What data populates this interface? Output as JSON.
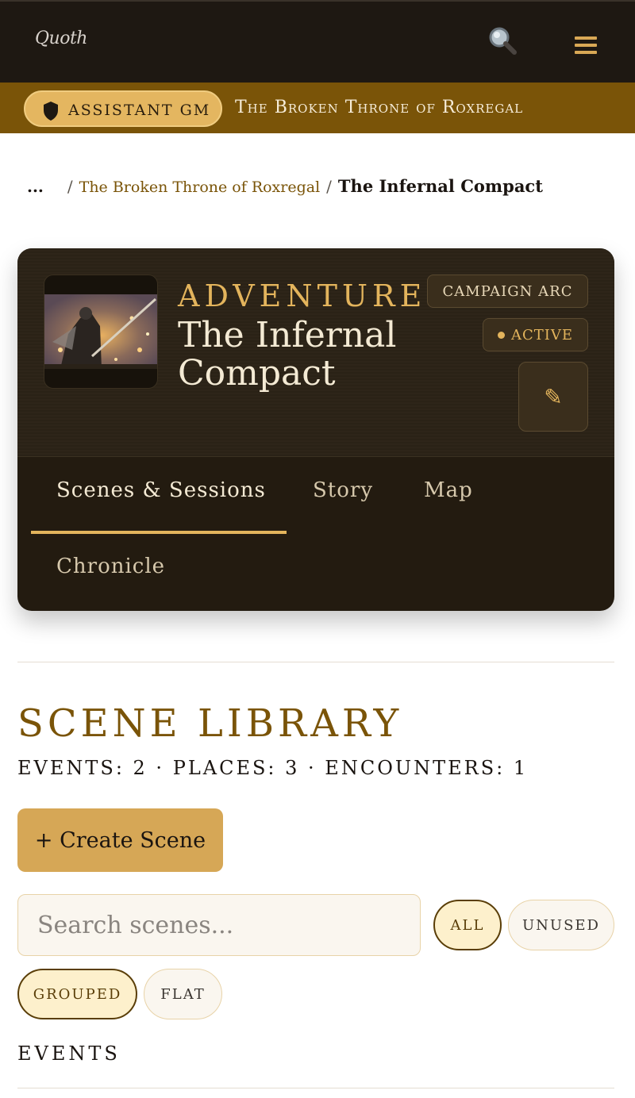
{
  "header": {
    "logo_text": "Quoth",
    "search_icon": "magnifier-icon",
    "menu_icon": "hamburger-menu-icon"
  },
  "role_bar": {
    "role_label": "ASSISTANT GM",
    "campaign_name": "The Broken Throne of Roxregal"
  },
  "breadcrumb": {
    "ellipsis": "...",
    "separator": "/",
    "parent": "The Broken Throne of Roxregal",
    "current": "The Infernal Compact"
  },
  "adventure": {
    "kind_label": "ADVENTURE",
    "title": "The Infernal Compact",
    "badge_arc": "CAMPAIGN ARC",
    "badge_status": "ACTIVE",
    "edit_icon": "pencil-icon"
  },
  "tabs": [
    {
      "label": "Scenes & Sessions",
      "active": true
    },
    {
      "label": "Story",
      "active": false
    },
    {
      "label": "Map",
      "active": false
    },
    {
      "label": "Chronicle",
      "active": false
    }
  ],
  "library": {
    "title": "SCENE LIBRARY",
    "stats": "EVENTS: 2 · PLACES: 3 · ENCOUNTERS: 1",
    "create_label": "+ Create Scene",
    "search_placeholder": "Search scenes...",
    "filter_all": "ALL",
    "filter_unused": "UNUSED",
    "view_grouped": "GROUPED",
    "view_flat": "FLAT",
    "section_events": "EVENTS"
  },
  "colors": {
    "accent": "#d6a756",
    "header_bg": "#1e1812",
    "role_bar_bg": "#7a5408",
    "card_bg": "#231b10"
  }
}
